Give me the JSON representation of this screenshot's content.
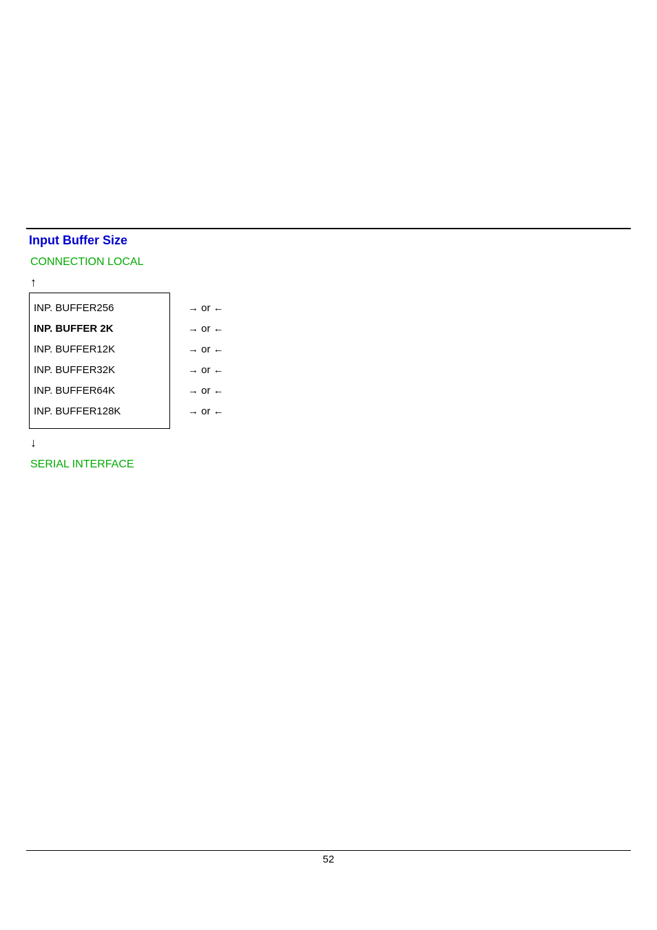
{
  "section": {
    "title": "Input Buffer Size",
    "link_above": "CONNECTION LOCAL",
    "link_below": "SERIAL INTERFACE",
    "arrow_up": "↑",
    "arrow_down": "↓",
    "nav_text": "→ or ←"
  },
  "options": [
    {
      "label": "INP. BUFFER256",
      "bold": false
    },
    {
      "label": "INP. BUFFER 2K",
      "bold": true
    },
    {
      "label": "INP. BUFFER12K",
      "bold": false
    },
    {
      "label": "INP. BUFFER32K",
      "bold": false
    },
    {
      "label": "INP. BUFFER64K",
      "bold": false
    },
    {
      "label": "INP. BUFFER128K",
      "bold": false
    }
  ],
  "page_number": "52"
}
